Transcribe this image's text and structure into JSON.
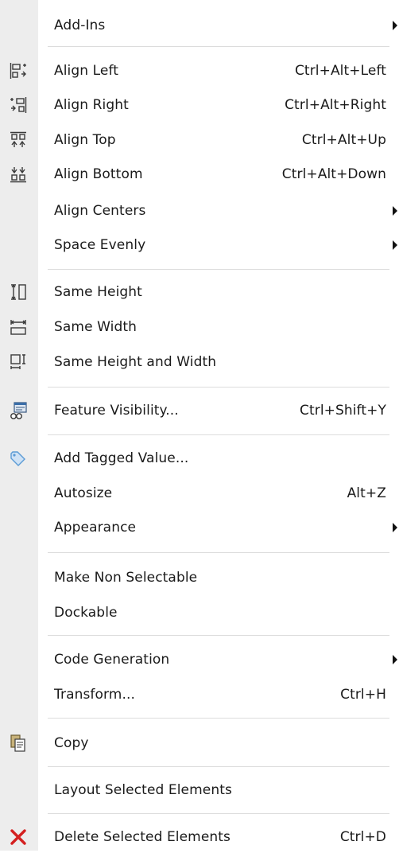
{
  "menu": {
    "items": [
      {
        "label": "Add-Ins",
        "shortcut": "",
        "submenu": true,
        "icon": ""
      },
      {
        "label": "Align Left",
        "shortcut": "Ctrl+Alt+Left",
        "submenu": false,
        "icon": "align-left-icon"
      },
      {
        "label": "Align Right",
        "shortcut": "Ctrl+Alt+Right",
        "submenu": false,
        "icon": "align-right-icon"
      },
      {
        "label": "Align Top",
        "shortcut": "Ctrl+Alt+Up",
        "submenu": false,
        "icon": "align-top-icon"
      },
      {
        "label": "Align Bottom",
        "shortcut": "Ctrl+Alt+Down",
        "submenu": false,
        "icon": "align-bottom-icon"
      },
      {
        "label": "Align Centers",
        "shortcut": "",
        "submenu": true,
        "icon": ""
      },
      {
        "label": "Space Evenly",
        "shortcut": "",
        "submenu": true,
        "icon": ""
      },
      {
        "label": "Same Height",
        "shortcut": "",
        "submenu": false,
        "icon": "same-height-icon"
      },
      {
        "label": "Same Width",
        "shortcut": "",
        "submenu": false,
        "icon": "same-width-icon"
      },
      {
        "label": "Same Height and Width",
        "shortcut": "",
        "submenu": false,
        "icon": "same-height-width-icon"
      },
      {
        "label": "Feature Visibility...",
        "shortcut": "Ctrl+Shift+Y",
        "submenu": false,
        "icon": "feature-visibility-icon"
      },
      {
        "label": "Add Tagged Value...",
        "shortcut": "",
        "submenu": false,
        "icon": "tag-icon"
      },
      {
        "label": "Autosize",
        "shortcut": "Alt+Z",
        "submenu": false,
        "icon": ""
      },
      {
        "label": "Appearance",
        "shortcut": "",
        "submenu": true,
        "icon": ""
      },
      {
        "label": "Make Non Selectable",
        "shortcut": "",
        "submenu": false,
        "icon": ""
      },
      {
        "label": "Dockable",
        "shortcut": "",
        "submenu": false,
        "icon": ""
      },
      {
        "label": "Code Generation",
        "shortcut": "",
        "submenu": true,
        "icon": ""
      },
      {
        "label": "Transform...",
        "shortcut": "Ctrl+H",
        "submenu": false,
        "icon": ""
      },
      {
        "label": "Copy",
        "shortcut": "",
        "submenu": false,
        "icon": "copy-icon"
      },
      {
        "label": "Layout Selected Elements",
        "shortcut": "",
        "submenu": false,
        "icon": ""
      },
      {
        "label": "Delete Selected Elements",
        "shortcut": "Ctrl+D",
        "submenu": false,
        "icon": "delete-icon"
      }
    ]
  },
  "colors": {
    "gutter": "#ededed",
    "separator": "#dcdcdc",
    "delete": "#d42020",
    "tag": "#5b9bd5"
  }
}
